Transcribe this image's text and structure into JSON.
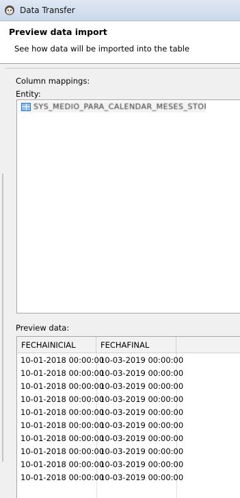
{
  "window": {
    "title": "Data Transfer"
  },
  "header": {
    "title": "Preview data import",
    "subtitle": "See how data will be imported into the table"
  },
  "mappings": {
    "label": "Column mappings:",
    "entity_label": "Entity:",
    "entity_name": "SYS_MEDIO_PARA_CALENDAR_MESES_STOREO"
  },
  "preview": {
    "label": "Preview data:",
    "columns": [
      "FECHAINICIAL",
      "FECHAFINAL"
    ],
    "rows": [
      [
        "10-01-2018 00:00:00",
        "10-03-2019 00:00:00"
      ],
      [
        "10-01-2018 00:00:00",
        "10-03-2019 00:00:00"
      ],
      [
        "10-01-2018 00:00:00",
        "10-03-2019 00:00:00"
      ],
      [
        "10-01-2018 00:00:00",
        "10-03-2019 00:00:00"
      ],
      [
        "10-01-2018 00:00:00",
        "10-03-2019 00:00:00"
      ],
      [
        "10-01-2018 00:00:00",
        "10-03-2019 00:00:00"
      ],
      [
        "10-01-2018 00:00:00",
        "10-03-2019 00:00:00"
      ],
      [
        "10-01-2018 00:00:00",
        "10-03-2019 00:00:00"
      ],
      [
        "10-01-2018 00:00:00",
        "10-03-2019 00:00:00"
      ],
      [
        "10-01-2018 00:00:00",
        "10-03-2019 00:00:00"
      ]
    ]
  },
  "icons": {
    "app": "dbeaver-beaver-icon",
    "entity": "table-icon"
  }
}
